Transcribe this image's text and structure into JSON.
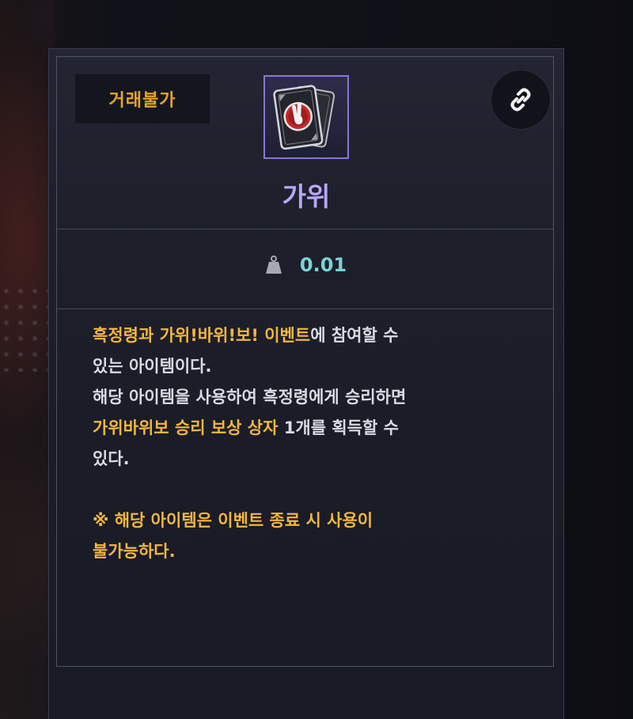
{
  "tooltip": {
    "trade_badge": "거래불가",
    "item_name": "가위",
    "weight": "0.01",
    "icons": {
      "item": "rock-paper-scissors-card-icon",
      "link": "link-icon",
      "weight": "weight-icon"
    },
    "colors": {
      "name": "#b8a6f5",
      "highlight": "#f2b640",
      "weight": "#7ad3d6",
      "icon_border": "#8a75d6"
    },
    "description": {
      "line1_hl_a": "흑정령과 가위!바위!보! 이벤트",
      "line1_rest": "에 참여할 수",
      "line2": "있는 아이템이다.",
      "line3": "해당 아이템을 사용하여 흑정령에게 승리하면",
      "line4_hl": "가위바위보 승리 보상 상자",
      "line4_rest": " 1개를 획득할 수",
      "line5": "있다.",
      "warning_line1": "※ 해당 아이템은 이벤트 종료 시 사용이",
      "warning_line2": "불가능하다."
    }
  }
}
